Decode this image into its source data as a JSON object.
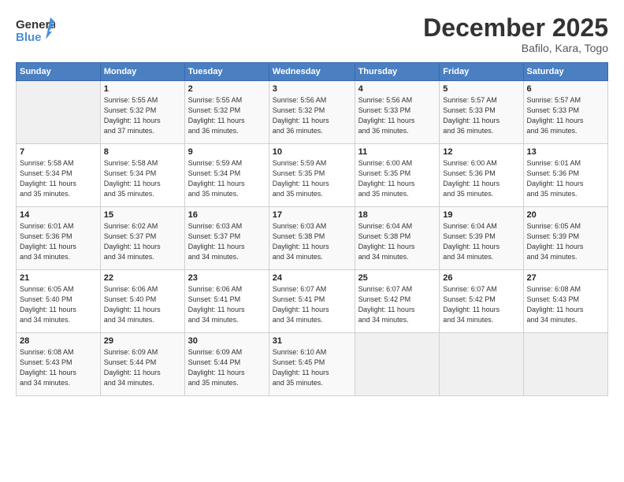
{
  "header": {
    "logo_general": "General",
    "logo_blue": "Blue",
    "month_title": "December 2025",
    "location": "Bafilo, Kara, Togo"
  },
  "weekdays": [
    "Sunday",
    "Monday",
    "Tuesday",
    "Wednesday",
    "Thursday",
    "Friday",
    "Saturday"
  ],
  "weeks": [
    [
      {
        "day": "",
        "info": ""
      },
      {
        "day": "1",
        "info": "Sunrise: 5:55 AM\nSunset: 5:32 PM\nDaylight: 11 hours\nand 37 minutes."
      },
      {
        "day": "2",
        "info": "Sunrise: 5:55 AM\nSunset: 5:32 PM\nDaylight: 11 hours\nand 36 minutes."
      },
      {
        "day": "3",
        "info": "Sunrise: 5:56 AM\nSunset: 5:32 PM\nDaylight: 11 hours\nand 36 minutes."
      },
      {
        "day": "4",
        "info": "Sunrise: 5:56 AM\nSunset: 5:33 PM\nDaylight: 11 hours\nand 36 minutes."
      },
      {
        "day": "5",
        "info": "Sunrise: 5:57 AM\nSunset: 5:33 PM\nDaylight: 11 hours\nand 36 minutes."
      },
      {
        "day": "6",
        "info": "Sunrise: 5:57 AM\nSunset: 5:33 PM\nDaylight: 11 hours\nand 36 minutes."
      }
    ],
    [
      {
        "day": "7",
        "info": "Sunrise: 5:58 AM\nSunset: 5:34 PM\nDaylight: 11 hours\nand 35 minutes."
      },
      {
        "day": "8",
        "info": "Sunrise: 5:58 AM\nSunset: 5:34 PM\nDaylight: 11 hours\nand 35 minutes."
      },
      {
        "day": "9",
        "info": "Sunrise: 5:59 AM\nSunset: 5:34 PM\nDaylight: 11 hours\nand 35 minutes."
      },
      {
        "day": "10",
        "info": "Sunrise: 5:59 AM\nSunset: 5:35 PM\nDaylight: 11 hours\nand 35 minutes."
      },
      {
        "day": "11",
        "info": "Sunrise: 6:00 AM\nSunset: 5:35 PM\nDaylight: 11 hours\nand 35 minutes."
      },
      {
        "day": "12",
        "info": "Sunrise: 6:00 AM\nSunset: 5:36 PM\nDaylight: 11 hours\nand 35 minutes."
      },
      {
        "day": "13",
        "info": "Sunrise: 6:01 AM\nSunset: 5:36 PM\nDaylight: 11 hours\nand 35 minutes."
      }
    ],
    [
      {
        "day": "14",
        "info": "Sunrise: 6:01 AM\nSunset: 5:36 PM\nDaylight: 11 hours\nand 34 minutes."
      },
      {
        "day": "15",
        "info": "Sunrise: 6:02 AM\nSunset: 5:37 PM\nDaylight: 11 hours\nand 34 minutes."
      },
      {
        "day": "16",
        "info": "Sunrise: 6:03 AM\nSunset: 5:37 PM\nDaylight: 11 hours\nand 34 minutes."
      },
      {
        "day": "17",
        "info": "Sunrise: 6:03 AM\nSunset: 5:38 PM\nDaylight: 11 hours\nand 34 minutes."
      },
      {
        "day": "18",
        "info": "Sunrise: 6:04 AM\nSunset: 5:38 PM\nDaylight: 11 hours\nand 34 minutes."
      },
      {
        "day": "19",
        "info": "Sunrise: 6:04 AM\nSunset: 5:39 PM\nDaylight: 11 hours\nand 34 minutes."
      },
      {
        "day": "20",
        "info": "Sunrise: 6:05 AM\nSunset: 5:39 PM\nDaylight: 11 hours\nand 34 minutes."
      }
    ],
    [
      {
        "day": "21",
        "info": "Sunrise: 6:05 AM\nSunset: 5:40 PM\nDaylight: 11 hours\nand 34 minutes."
      },
      {
        "day": "22",
        "info": "Sunrise: 6:06 AM\nSunset: 5:40 PM\nDaylight: 11 hours\nand 34 minutes."
      },
      {
        "day": "23",
        "info": "Sunrise: 6:06 AM\nSunset: 5:41 PM\nDaylight: 11 hours\nand 34 minutes."
      },
      {
        "day": "24",
        "info": "Sunrise: 6:07 AM\nSunset: 5:41 PM\nDaylight: 11 hours\nand 34 minutes."
      },
      {
        "day": "25",
        "info": "Sunrise: 6:07 AM\nSunset: 5:42 PM\nDaylight: 11 hours\nand 34 minutes."
      },
      {
        "day": "26",
        "info": "Sunrise: 6:07 AM\nSunset: 5:42 PM\nDaylight: 11 hours\nand 34 minutes."
      },
      {
        "day": "27",
        "info": "Sunrise: 6:08 AM\nSunset: 5:43 PM\nDaylight: 11 hours\nand 34 minutes."
      }
    ],
    [
      {
        "day": "28",
        "info": "Sunrise: 6:08 AM\nSunset: 5:43 PM\nDaylight: 11 hours\nand 34 minutes."
      },
      {
        "day": "29",
        "info": "Sunrise: 6:09 AM\nSunset: 5:44 PM\nDaylight: 11 hours\nand 34 minutes."
      },
      {
        "day": "30",
        "info": "Sunrise: 6:09 AM\nSunset: 5:44 PM\nDaylight: 11 hours\nand 35 minutes."
      },
      {
        "day": "31",
        "info": "Sunrise: 6:10 AM\nSunset: 5:45 PM\nDaylight: 11 hours\nand 35 minutes."
      },
      {
        "day": "",
        "info": ""
      },
      {
        "day": "",
        "info": ""
      },
      {
        "day": "",
        "info": ""
      }
    ]
  ]
}
